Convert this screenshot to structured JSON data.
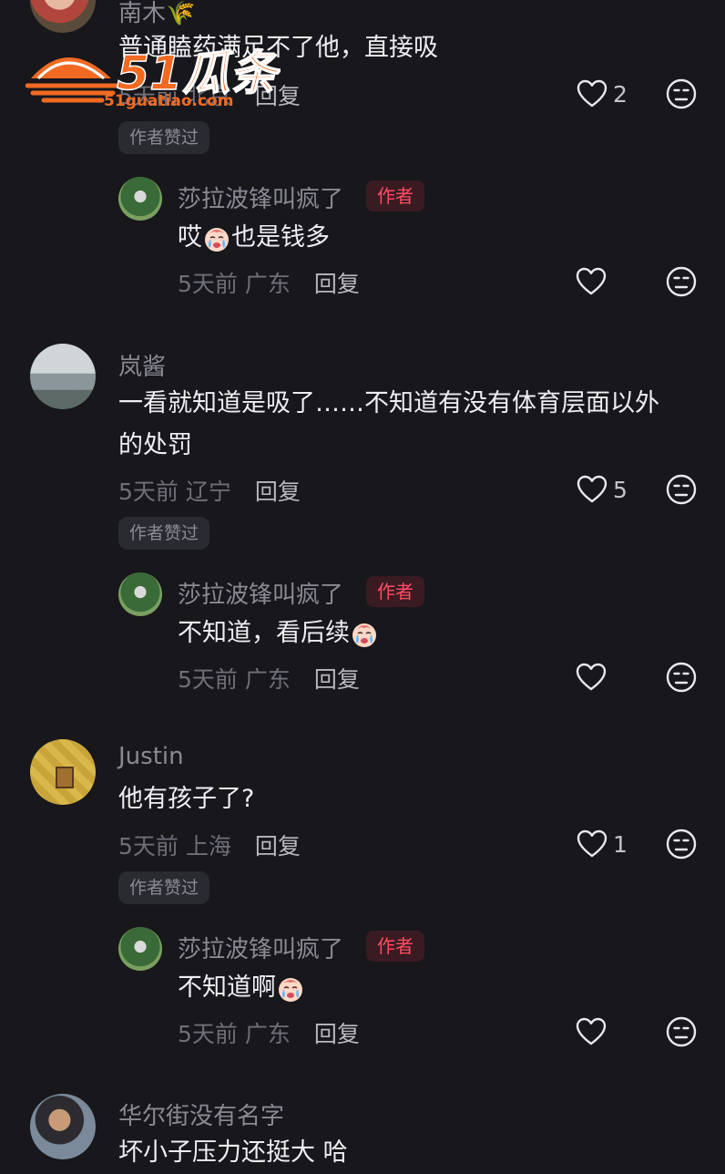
{
  "colors": {
    "background": "#17171c",
    "author_tag_bg": "#3a1b22",
    "author_tag_text": "#ff4d64",
    "name": "#8a8a93"
  },
  "watermark": {
    "brand": "51瓜条",
    "url": "51guatiao.com"
  },
  "author_tag_label": "作者",
  "liked_by_author_label": "作者赞过",
  "reply_label": "回复",
  "comments": [
    {
      "name": "南木🌾",
      "text": "普通瞌药满足不了他，直接吸",
      "time": "5天前",
      "location": "北京",
      "likes": "2",
      "author_liked": true,
      "reply": {
        "name": "莎拉波锋叫疯了",
        "text": "哎",
        "emoji": "crying-face",
        "text_after": "也是钱多",
        "time": "5天前",
        "location": "广东"
      }
    },
    {
      "name": "岚酱",
      "text_lines": [
        "一看就知道是吸了……不知道有没有体育层面以外",
        "的处罚"
      ],
      "time": "5天前",
      "location": "辽宁",
      "likes": "5",
      "author_liked": true,
      "reply": {
        "name": "莎拉波锋叫疯了",
        "text": "不知道，看后续",
        "emoji": "crying-face",
        "time": "5天前",
        "location": "广东"
      }
    },
    {
      "name": "Justin",
      "text": "他有孩子了?",
      "time": "5天前",
      "location": "上海",
      "likes": "1",
      "author_liked": true,
      "reply": {
        "name": "莎拉波锋叫疯了",
        "text": "不知道啊",
        "emoji": "crying-face",
        "time": "5天前",
        "location": "广东"
      }
    },
    {
      "name": "华尔街没有名字",
      "text": "坏小子压力还挺大 哈"
    }
  ]
}
